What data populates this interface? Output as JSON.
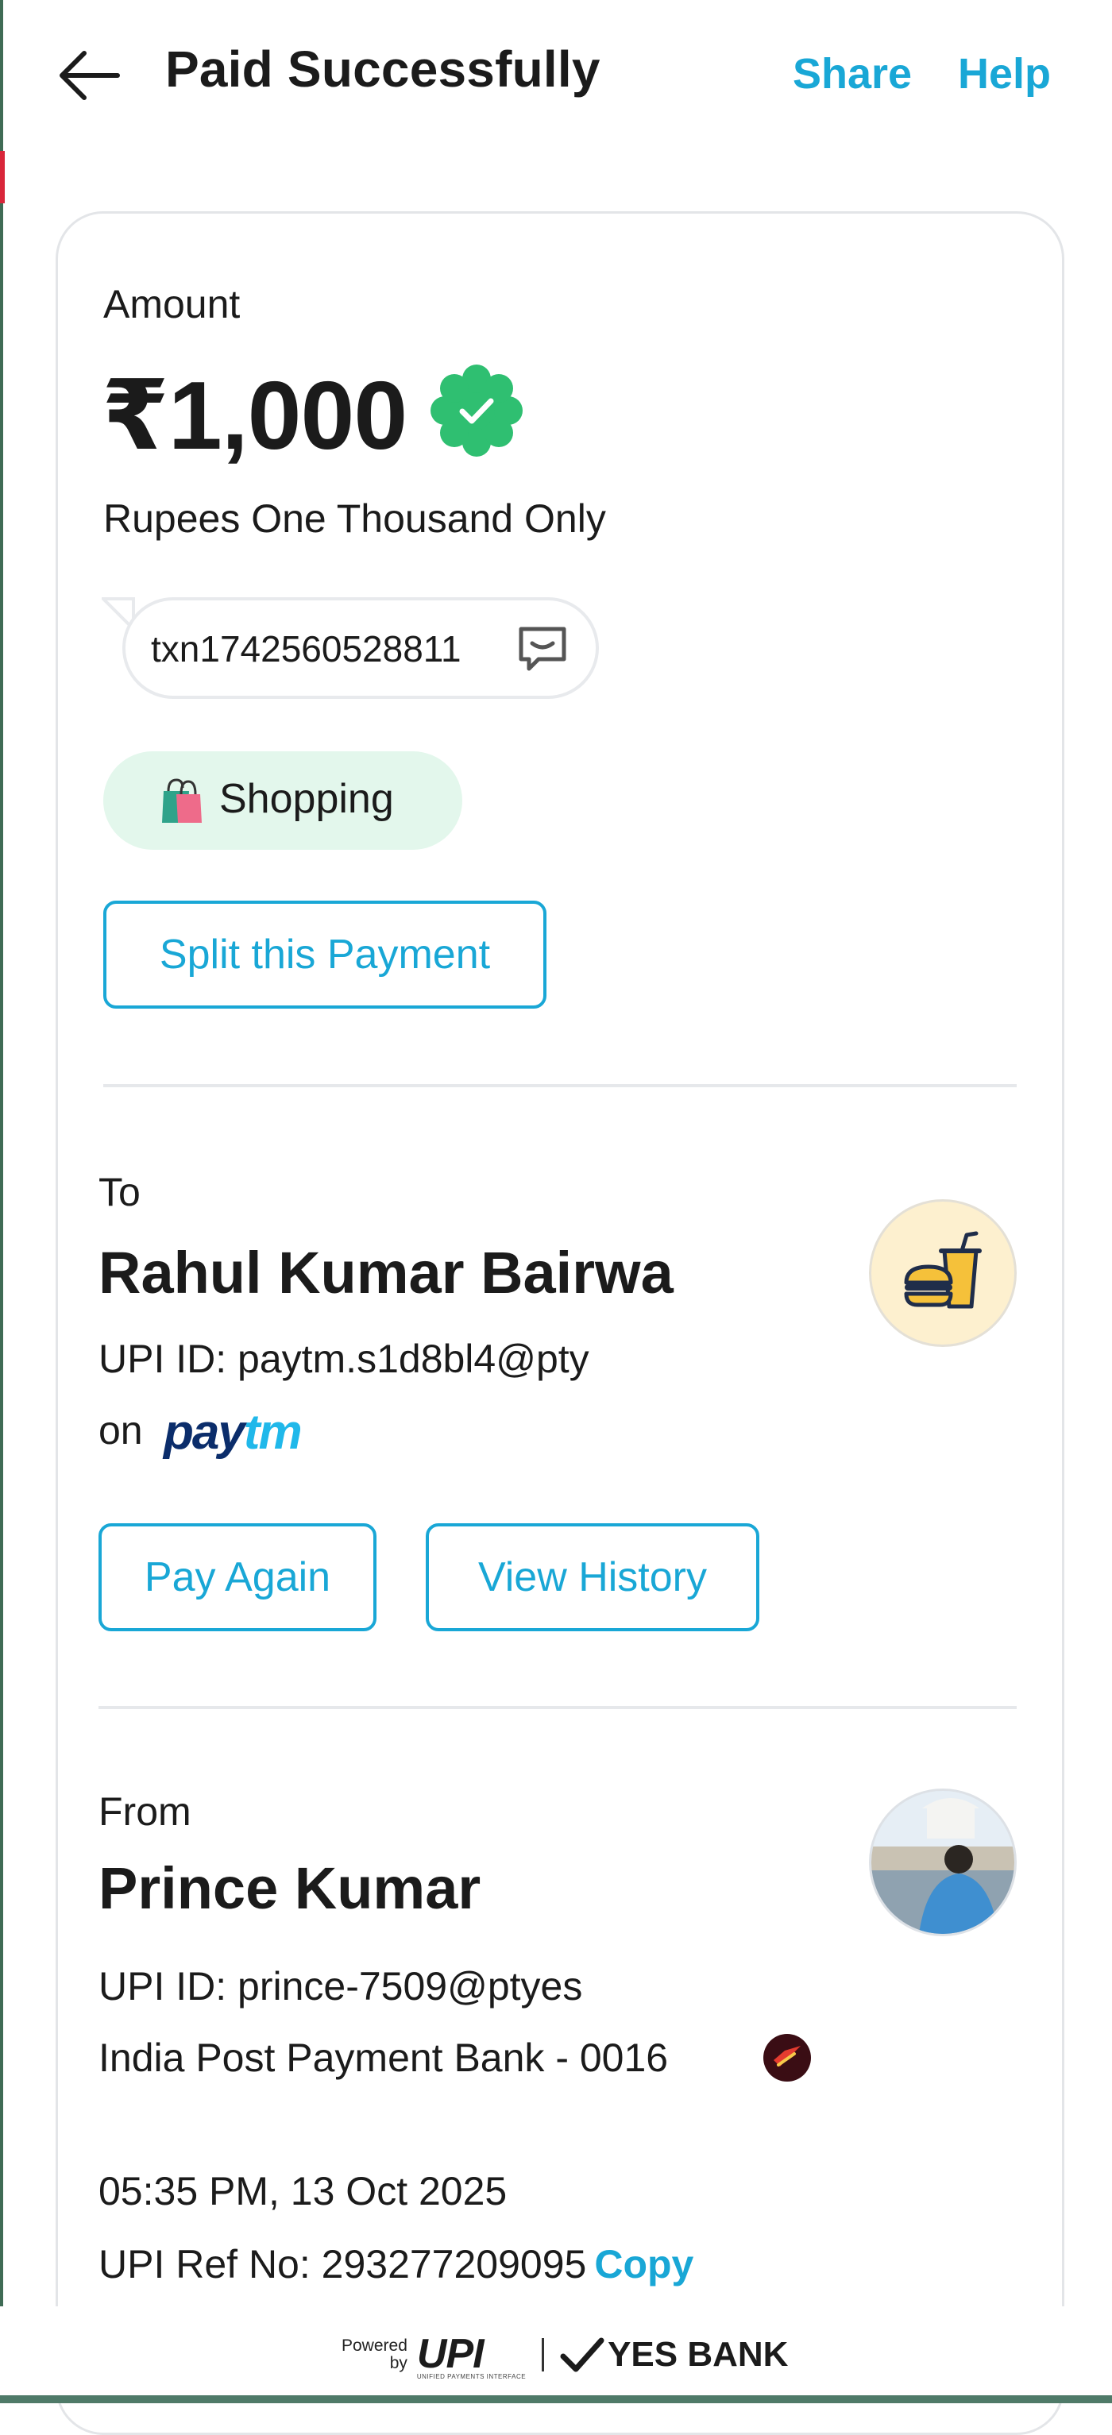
{
  "header": {
    "title": "Paid Successfully",
    "share_label": "Share",
    "help_label": "Help"
  },
  "payment": {
    "amount_label": "Amount",
    "amount": "₹1,000",
    "amount_words": "Rupees One Thousand Only",
    "transaction_note": "txn1742560528811",
    "category": "Shopping",
    "split_button": "Split this Payment"
  },
  "to": {
    "label": "To",
    "name": "Rahul Kumar Bairwa",
    "upi_id": "UPI ID: paytm.s1d8bl4@pty",
    "on_text": "on",
    "provider_pay": "pay",
    "provider_tm": "tm",
    "pay_again": "Pay Again",
    "view_history": "View History"
  },
  "from": {
    "label": "From",
    "name": "Prince Kumar",
    "upi_id": "UPI ID: prince-7509@ptyes",
    "bank": "India Post Payment Bank - 0016"
  },
  "details": {
    "datetime": "05:35 PM, 13 Oct 2025",
    "upi_ref": "UPI Ref No: 293277209095",
    "copy_label": "Copy"
  },
  "footer": {
    "powered_line1": "Powered",
    "powered_line2": "by",
    "upi": "UPI",
    "upi_tagline": "UNIFIED PAYMENTS INTERFACE",
    "bank": "YES BANK"
  },
  "colors": {
    "accent": "#19a7d6",
    "success_green": "#2fbf71",
    "chip_bg": "#e3f7ec"
  },
  "icons": {
    "back": "arrow-left-icon",
    "verified": "verified-badge-icon",
    "comment": "comment-icon",
    "category": "shopping-bag-icon",
    "merchant": "food-icon",
    "bank": "india-post-icon"
  }
}
